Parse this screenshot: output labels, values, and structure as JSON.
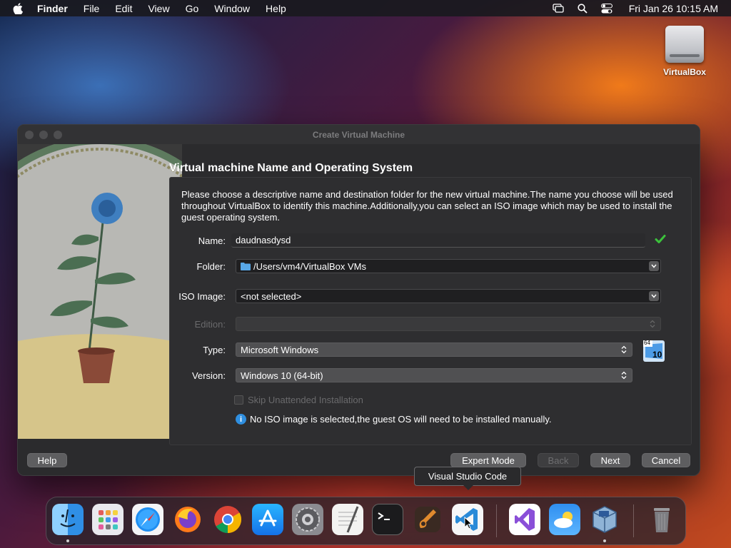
{
  "menubar": {
    "app_name": "Finder",
    "items": [
      "File",
      "Edit",
      "View",
      "Go",
      "Window",
      "Help"
    ],
    "clock": "Fri Jan 26  10:15 AM",
    "status_icons": [
      "screen-mirroring-icon",
      "spotlight-search-icon",
      "control-center-icon"
    ]
  },
  "desktop": {
    "icons": [
      {
        "label": "VirtualBox",
        "icon": "disk-drive-icon"
      }
    ]
  },
  "window": {
    "title": "Create Virtual Machine",
    "heading": "Virtual machine Name and Operating System",
    "description": "Please choose a descriptive name and destination folder for the new virtual machine.The name you choose will be used throughout VirtualBox to identify this machine.Additionally,you can select an ISO image which may be used to install the guest operating system.",
    "fields": {
      "name": {
        "label": "Name:",
        "value": "daudnasdysd",
        "valid_icon": "checkmark-icon",
        "valid_color": "#3cc23c"
      },
      "folder": {
        "label": "Folder:",
        "value": "/Users/vm4/VirtualBox VMs"
      },
      "iso": {
        "label": "ISO Image:",
        "value": "<not selected>"
      },
      "edition": {
        "label": "Edition:",
        "value": ""
      },
      "type": {
        "label": "Type:",
        "value": "Microsoft Windows"
      },
      "version": {
        "label": "Version:",
        "value": "Windows 10 (64-bit)"
      },
      "os_badge_top": "64",
      "os_badge_num": "10"
    },
    "skip_unattended": {
      "label": "Skip Unattended Installation",
      "checked": false,
      "enabled": false
    },
    "info_message": "No ISO image is selected,the guest OS will need to be installed manually.",
    "buttons": {
      "help": "Help",
      "expert": "Expert Mode",
      "back": "Back",
      "next": "Next",
      "cancel": "Cancel"
    }
  },
  "tooltip": "Visual Studio Code",
  "dock": {
    "apps": [
      {
        "name": "Finder",
        "icon": "finder-icon",
        "running": true
      },
      {
        "name": "Launchpad",
        "icon": "launchpad-icon",
        "running": false
      },
      {
        "name": "Safari",
        "icon": "safari-icon",
        "running": false
      },
      {
        "name": "Firefox",
        "icon": "firefox-icon",
        "running": false
      },
      {
        "name": "Google Chrome",
        "icon": "chrome-icon",
        "running": false
      },
      {
        "name": "App Store",
        "icon": "app-store-icon",
        "running": false
      },
      {
        "name": "System Preferences",
        "icon": "system-preferences-icon",
        "running": false
      },
      {
        "name": "TextEdit",
        "icon": "textedit-icon",
        "running": false
      },
      {
        "name": "Terminal",
        "icon": "terminal-icon",
        "running": false
      },
      {
        "name": "GarageBand",
        "icon": "garageband-icon",
        "running": false
      },
      {
        "name": "Visual Studio Code",
        "icon": "vscode-icon",
        "running": false
      },
      {
        "name": "Visual Studio",
        "icon": "visual-studio-icon",
        "running": false
      },
      {
        "name": "Weather",
        "icon": "weather-icon",
        "running": false
      },
      {
        "name": "VirtualBox",
        "icon": "virtualbox-icon",
        "running": true
      },
      {
        "name": "Trash",
        "icon": "trash-icon",
        "running": false
      }
    ]
  }
}
